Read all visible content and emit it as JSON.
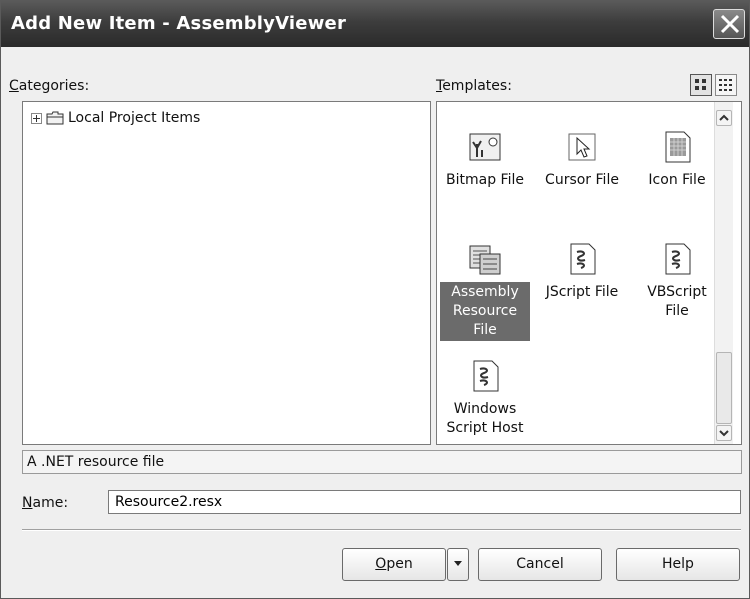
{
  "window": {
    "title": "Add New Item - AssemblyViewer"
  },
  "categories": {
    "label": "Categories:",
    "items": [
      {
        "label": "Local Project Items"
      }
    ]
  },
  "templates": {
    "label": "Templates:",
    "items": [
      {
        "label": "Bitmap File",
        "icon": "bitmap-file-icon",
        "selected": false
      },
      {
        "label": "Cursor File",
        "icon": "cursor-file-icon",
        "selected": false
      },
      {
        "label": "Icon File",
        "icon": "icon-file-icon",
        "selected": false
      },
      {
        "label": "Assembly Resource File",
        "icon": "resource-file-icon",
        "selected": true
      },
      {
        "label": "JScript File",
        "icon": "script-file-icon",
        "selected": false
      },
      {
        "label": "VBScript File",
        "icon": "script-file-icon",
        "selected": false
      },
      {
        "label": "Windows Script Host",
        "icon": "script-file-icon",
        "selected": false
      }
    ]
  },
  "description": "A .NET resource file",
  "name_field": {
    "label": "Name:",
    "value": "Resource2.resx"
  },
  "buttons": {
    "open": "Open",
    "cancel": "Cancel",
    "help": "Help"
  },
  "colors": {
    "title_bar": "#3d3d3d",
    "selection": "#6b6b6b",
    "dialog_bg": "#efefef"
  }
}
